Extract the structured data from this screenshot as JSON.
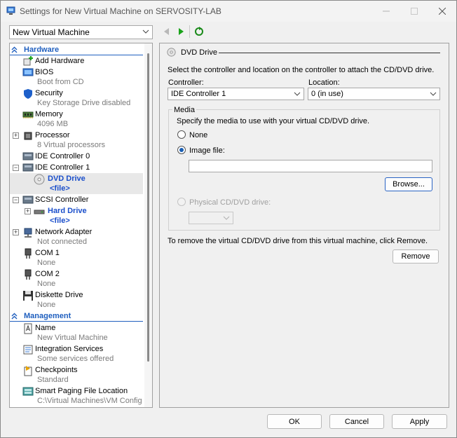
{
  "window": {
    "title": "Settings for New Virtual Machine on SERVOSITY-LAB",
    "vm_selector": "New Virtual Machine"
  },
  "tree": {
    "hardware_header": "Hardware",
    "management_header": "Management",
    "items": {
      "add_hardware": "Add Hardware",
      "bios": "BIOS",
      "bios_sub": "Boot from CD",
      "security": "Security",
      "security_sub": "Key Storage Drive disabled",
      "memory": "Memory",
      "memory_sub": "4096 MB",
      "processor": "Processor",
      "processor_sub": "8 Virtual processors",
      "ide0": "IDE Controller 0",
      "ide1": "IDE Controller 1",
      "dvd": "DVD Drive",
      "dvd_sub": "<file>",
      "scsi": "SCSI Controller",
      "hdd": "Hard Drive",
      "hdd_sub": "<file>",
      "net": "Network Adapter",
      "net_sub": "Not connected",
      "com1": "COM 1",
      "com1_sub": "None",
      "com2": "COM 2",
      "com2_sub": "None",
      "diskette": "Diskette Drive",
      "diskette_sub": "None",
      "name": "Name",
      "name_sub": "New Virtual Machine",
      "integration": "Integration Services",
      "integration_sub": "Some services offered",
      "checkpoints": "Checkpoints",
      "checkpoints_sub": "Standard",
      "paging": "Smart Paging File Location",
      "paging_sub": "C:\\Virtual Machines\\VM Config"
    }
  },
  "pane": {
    "title": "DVD Drive",
    "instructions": "Select the controller and location on the controller to attach the CD/DVD drive.",
    "controller_label": "Controller:",
    "controller_value": "IDE Controller 1",
    "location_label": "Location:",
    "location_value": "0 (in use)",
    "media_label": "Media",
    "media_instructions": "Specify the media to use with your virtual CD/DVD drive.",
    "none_label": "None",
    "image_label": "Image file:",
    "image_value": "",
    "browse_label": "Browse...",
    "physical_label": "Physical CD/DVD drive:",
    "remove_text": "To remove the virtual CD/DVD drive from this virtual machine, click Remove.",
    "remove_label": "Remove"
  },
  "footer": {
    "ok": "OK",
    "cancel": "Cancel",
    "apply": "Apply"
  },
  "colors": {
    "accent": "#1f5fbf",
    "selection": "#e8e8e8",
    "nav_green": "#1aa31a"
  }
}
